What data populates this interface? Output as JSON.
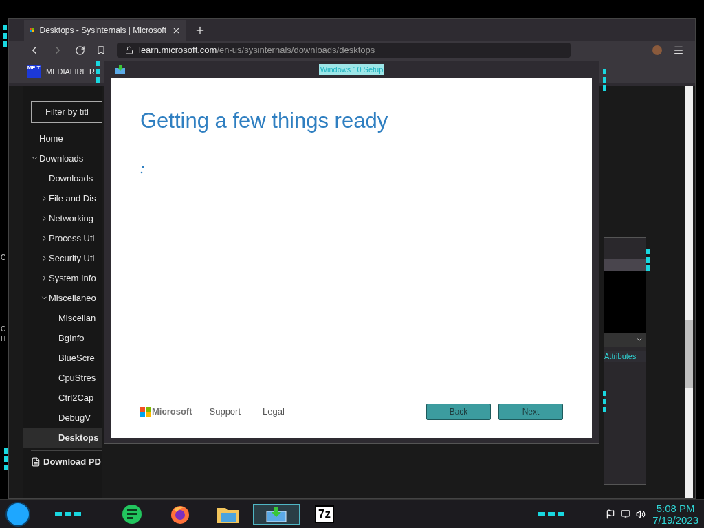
{
  "desktop": {
    "fragments": [
      "C",
      "C",
      "H"
    ]
  },
  "browser": {
    "tab": {
      "title": "Desktops - Sysinternals | Microsoft",
      "selected": true
    },
    "address": {
      "host": "learn.microsoft.com",
      "path": "/en-us/sysinternals/downloads/desktops"
    },
    "bookmark": {
      "badge": "MF T",
      "label": "MEDIAFIRE R"
    },
    "sidebar": {
      "filter": {
        "placeholder": "Filter by titl"
      },
      "items": [
        {
          "label": "Home",
          "selected": false
        },
        {
          "label": "Downloads",
          "selected": false,
          "expanded": true,
          "children": [
            {
              "label": "Downloads",
              "selected": false
            },
            {
              "label": "File and Dis",
              "selected": false,
              "expanded": false
            },
            {
              "label": "Networking",
              "selected": false,
              "expanded": false
            },
            {
              "label": "Process Uti",
              "selected": false,
              "expanded": false
            },
            {
              "label": "Security Uti",
              "selected": false,
              "expanded": false
            },
            {
              "label": "System Info",
              "selected": false,
              "expanded": false
            },
            {
              "label": "Miscellaneo",
              "selected": false,
              "expanded": true,
              "children": [
                {
                  "label": "Miscellan",
                  "selected": false
                },
                {
                  "label": "BgInfo",
                  "selected": false
                },
                {
                  "label": "BlueScre",
                  "selected": false
                },
                {
                  "label": "CpuStres",
                  "selected": false
                },
                {
                  "label": "Ctrl2Cap",
                  "selected": false
                },
                {
                  "label": "DebugV",
                  "selected": false
                },
                {
                  "label": "Desktops",
                  "selected": true
                }
              ]
            }
          ]
        }
      ],
      "download_pdf": "Download PD"
    }
  },
  "back_window": {
    "link": "Attributes"
  },
  "setup": {
    "title": "Windows 10 Setup",
    "heading": "Getting a few things ready",
    "brand": "Microsoft",
    "links": [
      "Support",
      "Legal"
    ],
    "buttons": [
      "Back",
      "Next"
    ]
  },
  "taskbar": {
    "apps": [
      {
        "kind": "notes",
        "selected": false
      },
      {
        "kind": "firefox",
        "selected": false
      },
      {
        "kind": "folder",
        "selected": false
      },
      {
        "kind": "setup",
        "selected": true
      },
      {
        "kind": "zip",
        "label": "7z",
        "selected": false
      }
    ],
    "time": "5:08 PM",
    "date": "7/19/2023"
  }
}
